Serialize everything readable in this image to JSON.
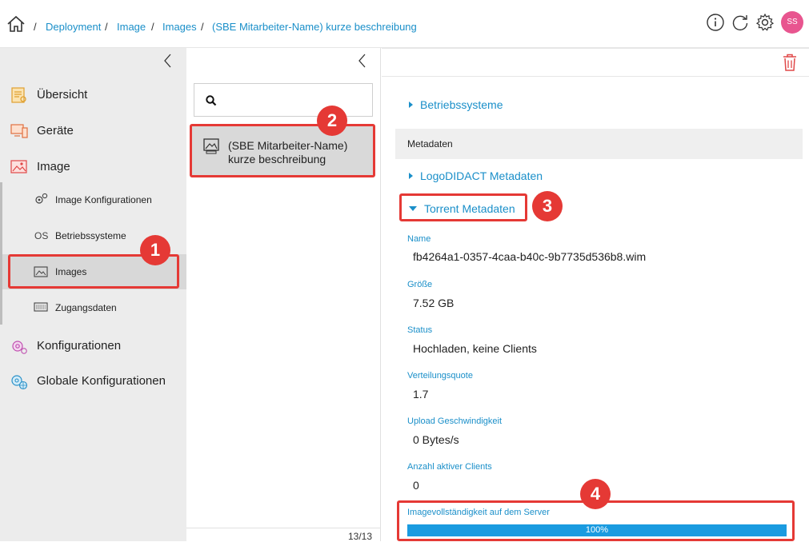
{
  "breadcrumb": [
    "Deployment",
    "Image",
    "Images",
    "(SBE Mitarbeiter-Name) kurze beschreibung"
  ],
  "breadcrumb_separator": "/",
  "user": {
    "initials": "SS",
    "color": "#e8558f"
  },
  "toolbar_icons": [
    "info-icon",
    "refresh-icon",
    "gear-icon"
  ],
  "sidebar": {
    "items": [
      {
        "label": "Übersicht",
        "icon": "overview-icon"
      },
      {
        "label": "Geräte",
        "icon": "devices-icon"
      },
      {
        "label": "Image",
        "icon": "image-icon"
      },
      {
        "label": "Konfigurationen",
        "icon": "configurations-icon"
      },
      {
        "label": "Globale Konfigurationen",
        "icon": "global-config-icon"
      }
    ],
    "subitems": [
      {
        "label": "Image Konfigurationen",
        "icon": "gears-icon"
      },
      {
        "label": "Betriebssysteme",
        "icon_text": "OS"
      },
      {
        "label": "Images",
        "icon": "image-small-icon",
        "active": true
      },
      {
        "label": "Zugangsdaten",
        "icon": "credentials-icon"
      }
    ]
  },
  "middle": {
    "list_items": [
      {
        "label": "(SBE Mitarbeiter-Name) kurze beschreibung",
        "icon": "image-item-icon"
      }
    ],
    "page_count": "13/13"
  },
  "main": {
    "sections": {
      "betriebssysteme": "Betriebssysteme",
      "metadaten_header": "Metadaten",
      "logodidact": "LogoDIDACT Metadaten",
      "torrent": "Torrent Metadaten"
    },
    "fields": [
      {
        "label": "Name",
        "value": "fb4264a1-0357-4caa-b40c-9b7735d536b8.wim"
      },
      {
        "label": "Größe",
        "value": "7.52 GB"
      },
      {
        "label": "Status",
        "value": "Hochladen, keine Clients"
      },
      {
        "label": "Verteilungsquote",
        "value": "1.7"
      },
      {
        "label": "Upload Geschwindigkeit",
        "value": "0 Bytes/s"
      },
      {
        "label": "Anzahl aktiver Clients",
        "value": "0"
      }
    ],
    "progress": {
      "label": "Imagevollständigkeit auf dem Server",
      "value": 100,
      "text": "100%"
    }
  },
  "annotations": [
    "1",
    "2",
    "3",
    "4"
  ],
  "colors": {
    "accent": "#1a8fc9",
    "highlight": "#e53935",
    "progress": "#1a9be0"
  }
}
